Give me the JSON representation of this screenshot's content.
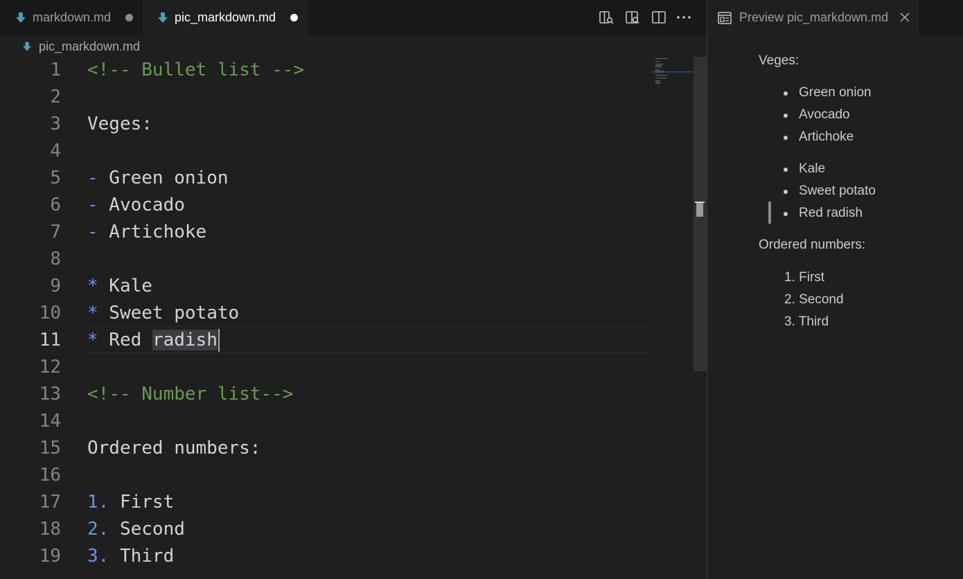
{
  "tabs": [
    {
      "name": "markdown.md",
      "active": false,
      "dirty": true
    },
    {
      "name": "pic_markdown.md",
      "active": true,
      "dirty": true
    }
  ],
  "toolbar": {
    "icons": [
      "open-preview-icon",
      "open-preview-to-side-icon",
      "split-editor-icon",
      "more-actions-icon"
    ]
  },
  "breadcrumb": {
    "file": "pic_markdown.md"
  },
  "editor": {
    "current_line": 11,
    "lines": [
      {
        "n": "1",
        "parts": [
          {
            "t": "<!-- Bullet list -->",
            "c": "comment"
          }
        ]
      },
      {
        "n": "2",
        "parts": []
      },
      {
        "n": "3",
        "parts": [
          {
            "t": "Veges:",
            "c": "text"
          }
        ]
      },
      {
        "n": "4",
        "parts": []
      },
      {
        "n": "5",
        "parts": [
          {
            "t": "-",
            "c": "marker"
          },
          {
            "t": " Green onion",
            "c": "text"
          }
        ]
      },
      {
        "n": "6",
        "parts": [
          {
            "t": "-",
            "c": "marker"
          },
          {
            "t": " Avocado",
            "c": "text"
          }
        ]
      },
      {
        "n": "7",
        "parts": [
          {
            "t": "-",
            "c": "marker"
          },
          {
            "t": " Artichoke",
            "c": "text"
          }
        ]
      },
      {
        "n": "8",
        "parts": []
      },
      {
        "n": "9",
        "parts": [
          {
            "t": "*",
            "c": "marker"
          },
          {
            "t": " Kale",
            "c": "text"
          }
        ]
      },
      {
        "n": "10",
        "parts": [
          {
            "t": "*",
            "c": "marker"
          },
          {
            "t": " Sweet potato",
            "c": "text"
          }
        ]
      },
      {
        "n": "11",
        "parts": [
          {
            "t": "*",
            "c": "marker"
          },
          {
            "t": " Red ",
            "c": "text"
          },
          {
            "t": "radish",
            "c": "highlight"
          }
        ]
      },
      {
        "n": "12",
        "parts": []
      },
      {
        "n": "13",
        "parts": [
          {
            "t": "<!-- Number list-->",
            "c": "comment"
          }
        ]
      },
      {
        "n": "14",
        "parts": []
      },
      {
        "n": "15",
        "parts": [
          {
            "t": "Ordered numbers:",
            "c": "text"
          }
        ]
      },
      {
        "n": "16",
        "parts": []
      },
      {
        "n": "17",
        "parts": [
          {
            "t": "1.",
            "c": "marker"
          },
          {
            "t": " First",
            "c": "text"
          }
        ]
      },
      {
        "n": "18",
        "parts": [
          {
            "t": "2.",
            "c": "marker"
          },
          {
            "t": " Second",
            "c": "text"
          }
        ]
      },
      {
        "n": "19",
        "parts": [
          {
            "t": "3.",
            "c": "marker"
          },
          {
            "t": " Third",
            "c": "text"
          }
        ]
      }
    ]
  },
  "preview": {
    "tab_title": "Preview pic_markdown.md",
    "heading1": "Veges:",
    "list1": [
      "Green onion",
      "Avocado",
      "Artichoke"
    ],
    "list2": [
      "Kale",
      "Sweet potato",
      "Red radish"
    ],
    "heading2": "Ordered numbers:",
    "ordered": [
      "1. First",
      "2. Second",
      "3. Third"
    ]
  },
  "colors": {
    "comment": "#6a9955",
    "marker": "#6796e6",
    "text": "#d4d4d4",
    "background": "#1f1f1f"
  }
}
